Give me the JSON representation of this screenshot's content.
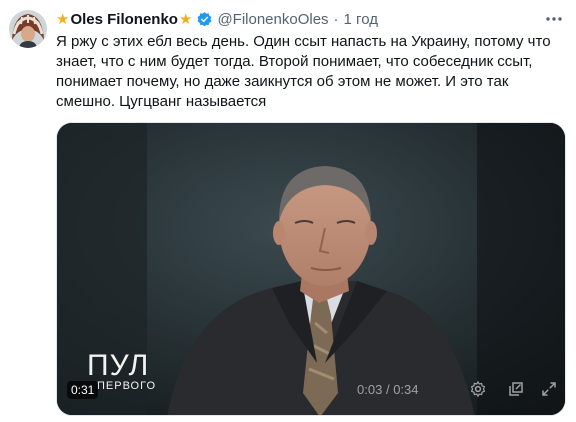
{
  "author": {
    "display_name": "Oles Filonenko",
    "name_prefix_emoji": "star",
    "name_suffix_emoji": "star",
    "verified": true,
    "handle": "@FilonenkoOles",
    "separator": "·",
    "time": "1 год"
  },
  "tweet": {
    "text": "Я ржу с этих ебл весь день. Один ссыт напасть на Украину, потому что знает, что с ним будет тогда. Второй понимает, что собеседник ссыт, понимает почему, но даже заикнутся об этом не может. И это так смешно. Цугцванг называется"
  },
  "video": {
    "watermark_big": "ПУЛ",
    "watermark_small": "ПЕРВОГО",
    "elapsed": "0:31",
    "current_time": "0:03",
    "duration": "0:34",
    "time_separator": "/",
    "controls": [
      "gear-icon",
      "pop-out-icon",
      "fullscreen-icon"
    ]
  },
  "colors": {
    "accent": "#1d9bf0",
    "secondary_text": "#536471",
    "star": "#f2b01e"
  }
}
